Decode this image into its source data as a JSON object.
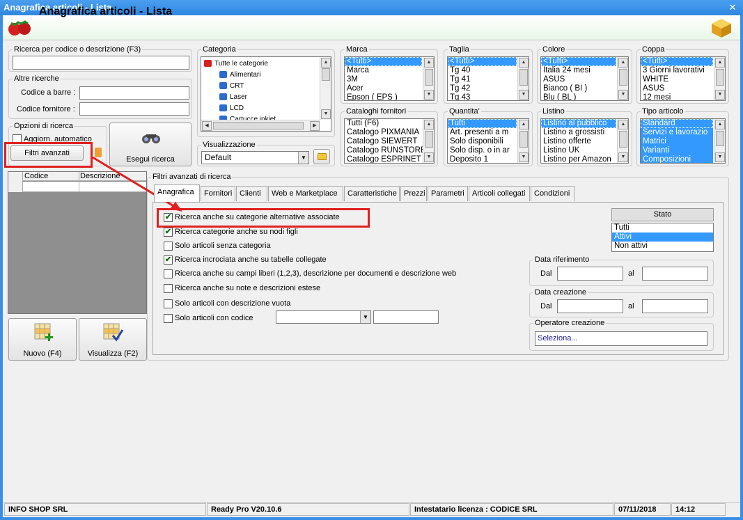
{
  "window": {
    "title": "Anagrafica articoli  - Lista",
    "heading": "Anagrafica articoli  - Lista",
    "close": "✕"
  },
  "search": {
    "group": "Ricerca per codice o descrizione (F3)",
    "value": ""
  },
  "other": {
    "group": "Altre ricerche",
    "barcode_label": "Codice a barre :",
    "supplier_label": "Codice fornitore :"
  },
  "options": {
    "group": "Opzioni di ricerca",
    "auto_label": "Aggiorn. automatico",
    "filters_button": "Filtri avanzati"
  },
  "search_button": "Esegui ricerca",
  "categoria": {
    "group": "Categoria",
    "items": [
      "Tutte le categorie",
      "Alimentari",
      "CRT",
      "Laser",
      "LCD",
      "Cartucce inkjet"
    ]
  },
  "visual": {
    "group": "Visualizzazione",
    "value": "Default"
  },
  "lists": {
    "marca": {
      "label": "Marca",
      "items": [
        "<Tutti>",
        "Marca",
        "3M",
        "Acer",
        "Epson ( EPS )"
      ]
    },
    "taglia": {
      "label": "Taglia",
      "items": [
        "<Tutti>",
        "Tg 40",
        "Tg 41",
        "Tg 42",
        "Tg 43"
      ]
    },
    "colore": {
      "label": "Colore",
      "items": [
        "<Tutti>",
        "Italia 24 mesi",
        "ASUS",
        "Bianco ( BI )",
        "Blu ( BL )"
      ]
    },
    "coppa": {
      "label": "Coppa",
      "items": [
        "<Tutti>",
        "3 Giorni lavorativi",
        "WHITE",
        "ASUS",
        "12 mesi"
      ]
    },
    "cataloghi": {
      "label": "Cataloghi fornitori",
      "items": [
        "Tutti (F6)",
        "Catalogo PIXMANIA",
        "Catalogo SIEWERT",
        "Catalogo RUNSTORE",
        "Catalogo ESPRINET"
      ]
    },
    "quantita": {
      "label": "Quantita'",
      "items": [
        "Tutti",
        "Art. presenti a m",
        "Solo disponibili",
        "Solo disp. o in ar",
        "Deposito 1"
      ]
    },
    "listino": {
      "label": "Listino",
      "items": [
        "Listino al pubblico",
        "Listino a grossisti",
        "Listino offerte",
        "Listino UK",
        "Listino per Amazon"
      ]
    },
    "tipo": {
      "label": "Tipo articolo",
      "items": [
        "Standard",
        "Servizi e lavorazio",
        "Matrici",
        "Varianti",
        "Composizioni"
      ]
    }
  },
  "grid": {
    "col1": "Codice",
    "col2": "Descrizione"
  },
  "buttons": {
    "new": "Nuovo (F4)",
    "view": "Visualizza (F2)"
  },
  "advanced": {
    "group": "Filtri avanzati di ricerca",
    "tabs": [
      "Anagrafica",
      "Fornitori",
      "Clienti",
      "Web e Marketplace",
      "Caratteristiche",
      "Prezzi",
      "Parametri",
      "Articoli collegati",
      "Condizioni"
    ],
    "checks": [
      {
        "label": "Ricerca anche su categorie alternative associate",
        "mark": "✔"
      },
      {
        "label": "Ricerca categorie anche su nodi figli",
        "mark": "✔"
      },
      {
        "label": "Solo articoli senza categoria",
        "mark": ""
      },
      {
        "label": "Ricerca incrociata anche su tabelle collegate",
        "mark": "✔"
      },
      {
        "label": "Ricerca anche su campi liberi (1,2,3), descrizione per documenti e descrizione web",
        "mark": ""
      },
      {
        "label": "Ricerca anche su note e descrizioni estese",
        "mark": ""
      },
      {
        "label": "Solo articoli con descrizione vuota",
        "mark": ""
      },
      {
        "label": "Solo articoli con codice",
        "mark": ""
      }
    ],
    "stato": {
      "header": "Stato",
      "items": [
        "Tutti",
        "Attivi",
        "Non attivi"
      ]
    },
    "data_rif": {
      "group": "Data riferimento",
      "dal": "Dal",
      "al": "al"
    },
    "data_cre": {
      "group": "Data creazione",
      "dal": "Dal",
      "al": "al"
    },
    "operatore": {
      "group": "Operatore creazione",
      "value": "Seleziona..."
    }
  },
  "status": {
    "company": "INFO SHOP SRL",
    "version": "Ready Pro V20.10.6",
    "license": "Intestatario licenza : CODICE SRL",
    "date": "07/11/2018",
    "time": "14:12"
  }
}
